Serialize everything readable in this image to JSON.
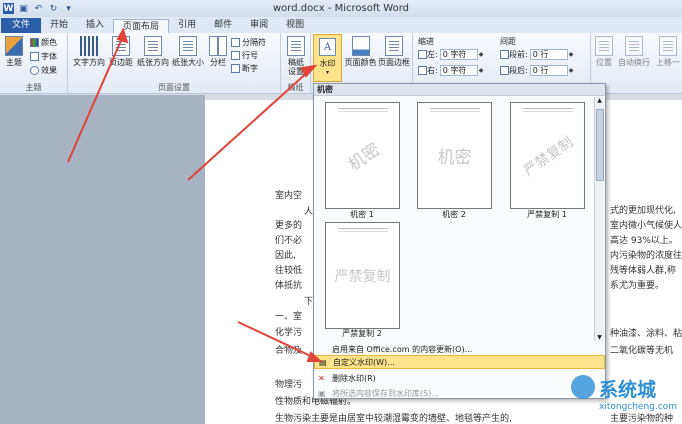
{
  "window": {
    "title": "word.docx - Microsoft Word"
  },
  "qat": {
    "icons": [
      "word-icon",
      "save-icon",
      "undo-icon",
      "redo-icon",
      "customize-icon"
    ]
  },
  "tabs": [
    "文件",
    "开始",
    "插入",
    "页面布局",
    "引用",
    "邮件",
    "审阅",
    "视图"
  ],
  "ribbon": {
    "theme_group": {
      "label": "主题",
      "theme_btn": "主题",
      "colors": "颜色",
      "fonts": "字体",
      "effects": "效果"
    },
    "page_setup": {
      "label": "页面设置",
      "text_dir": "文字方向",
      "margins": "页边距",
      "orientation": "纸张方向",
      "size": "纸张大小",
      "columns": "分栏",
      "breaks": "分隔符",
      "line_numbers": "行号",
      "hyphenation": "断字"
    },
    "draft": {
      "line1": "稿纸",
      "line2": "设置",
      "group": "稿纸"
    },
    "background": {
      "watermark": "水印",
      "page_color": "页面颜色",
      "page_border": "页面边框"
    },
    "paragraph": {
      "indent_label": "缩进",
      "spacing_label": "间距",
      "left_label": "左:",
      "left_value": "0 字符",
      "right_label": "右:",
      "right_value": "0 字符",
      "before_label": "段前:",
      "before_value": "0 行",
      "after_label": "段后:",
      "after_value": "0 行"
    },
    "arrange": {
      "position": "位置",
      "wrap": "自动换行",
      "forward": "上移一"
    }
  },
  "document": {
    "lines": [
      "室内空",
      "人",
      "更多的",
      "们不必",
      "因此,",
      "往较低",
      "体抵抗",
      "下",
      "一、室",
      "化学污",
      "合物及",
      "物理污",
      "性物质和电磁辐射。",
      "生物污染主要是由居室中较潮湿霉变的墙壁、地毯等产生的,"
    ],
    "right_lines": [
      "式的更加现代化,",
      "室内微小气候使人",
      "高达 93%以上。",
      "内污染物的浓度往",
      "残等体弱人群,称",
      "系尤为重要。",
      "种油漆、涂料、粘",
      "二氧化碳等无机",
      "主要污染物的种"
    ]
  },
  "dropdown": {
    "header": "机密",
    "items": [
      {
        "label": "机密 1",
        "text": "机密"
      },
      {
        "label": "机密 2",
        "text": "机密"
      },
      {
        "label": "严禁复制 1",
        "text": "严禁复制"
      },
      {
        "label": "严禁复制 2",
        "text": "严禁复制"
      }
    ],
    "menu": [
      {
        "label": "启用来自 Office.com 的内容更新(O)...",
        "enabled": true
      },
      {
        "label": "自定义水印(W)...",
        "enabled": true
      },
      {
        "label": "删除水印(R)",
        "enabled": true
      },
      {
        "label": "将所选内容保存到水印库(S)...",
        "enabled": false
      }
    ]
  },
  "site_watermark": {
    "brand": "系统城",
    "url": "xitongcheng.com"
  },
  "colors": {
    "accent": "#2a5ea8",
    "highlight": "#fde38a",
    "arrow": "#e0433a"
  }
}
